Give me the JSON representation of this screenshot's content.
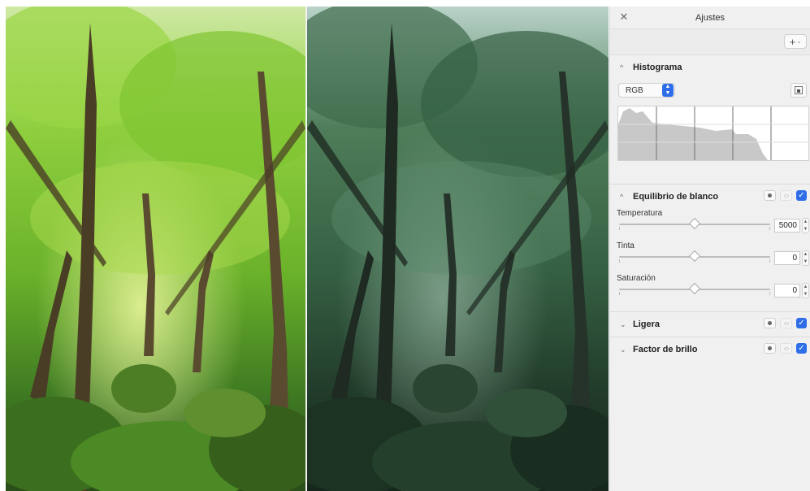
{
  "panel": {
    "title": "Ajustes",
    "close_icon": "close-icon",
    "add_icon": "plus-icon"
  },
  "histogram": {
    "title": "Histograma",
    "channel": "RGB",
    "icon": "histogram-image-icon"
  },
  "white_balance": {
    "title": "Equilibrio de blanco",
    "enabled": true,
    "sliders": [
      {
        "label": "Temperatura",
        "value": "5000",
        "position": 0.5
      },
      {
        "label": "Tinta",
        "value": "0",
        "position": 0.5
      },
      {
        "label": "Saturación",
        "value": "0",
        "position": 0.5
      }
    ]
  },
  "collapsed_sections": [
    {
      "title": "Ligera",
      "enabled": true
    },
    {
      "title": "Factor de brillo",
      "enabled": true
    }
  ],
  "colors": {
    "accent": "#2d6ee8",
    "panel_bg": "#f0f0f0",
    "original_foliage": "#7cbf2a",
    "adjusted_foliage": "#2f5b3a"
  }
}
